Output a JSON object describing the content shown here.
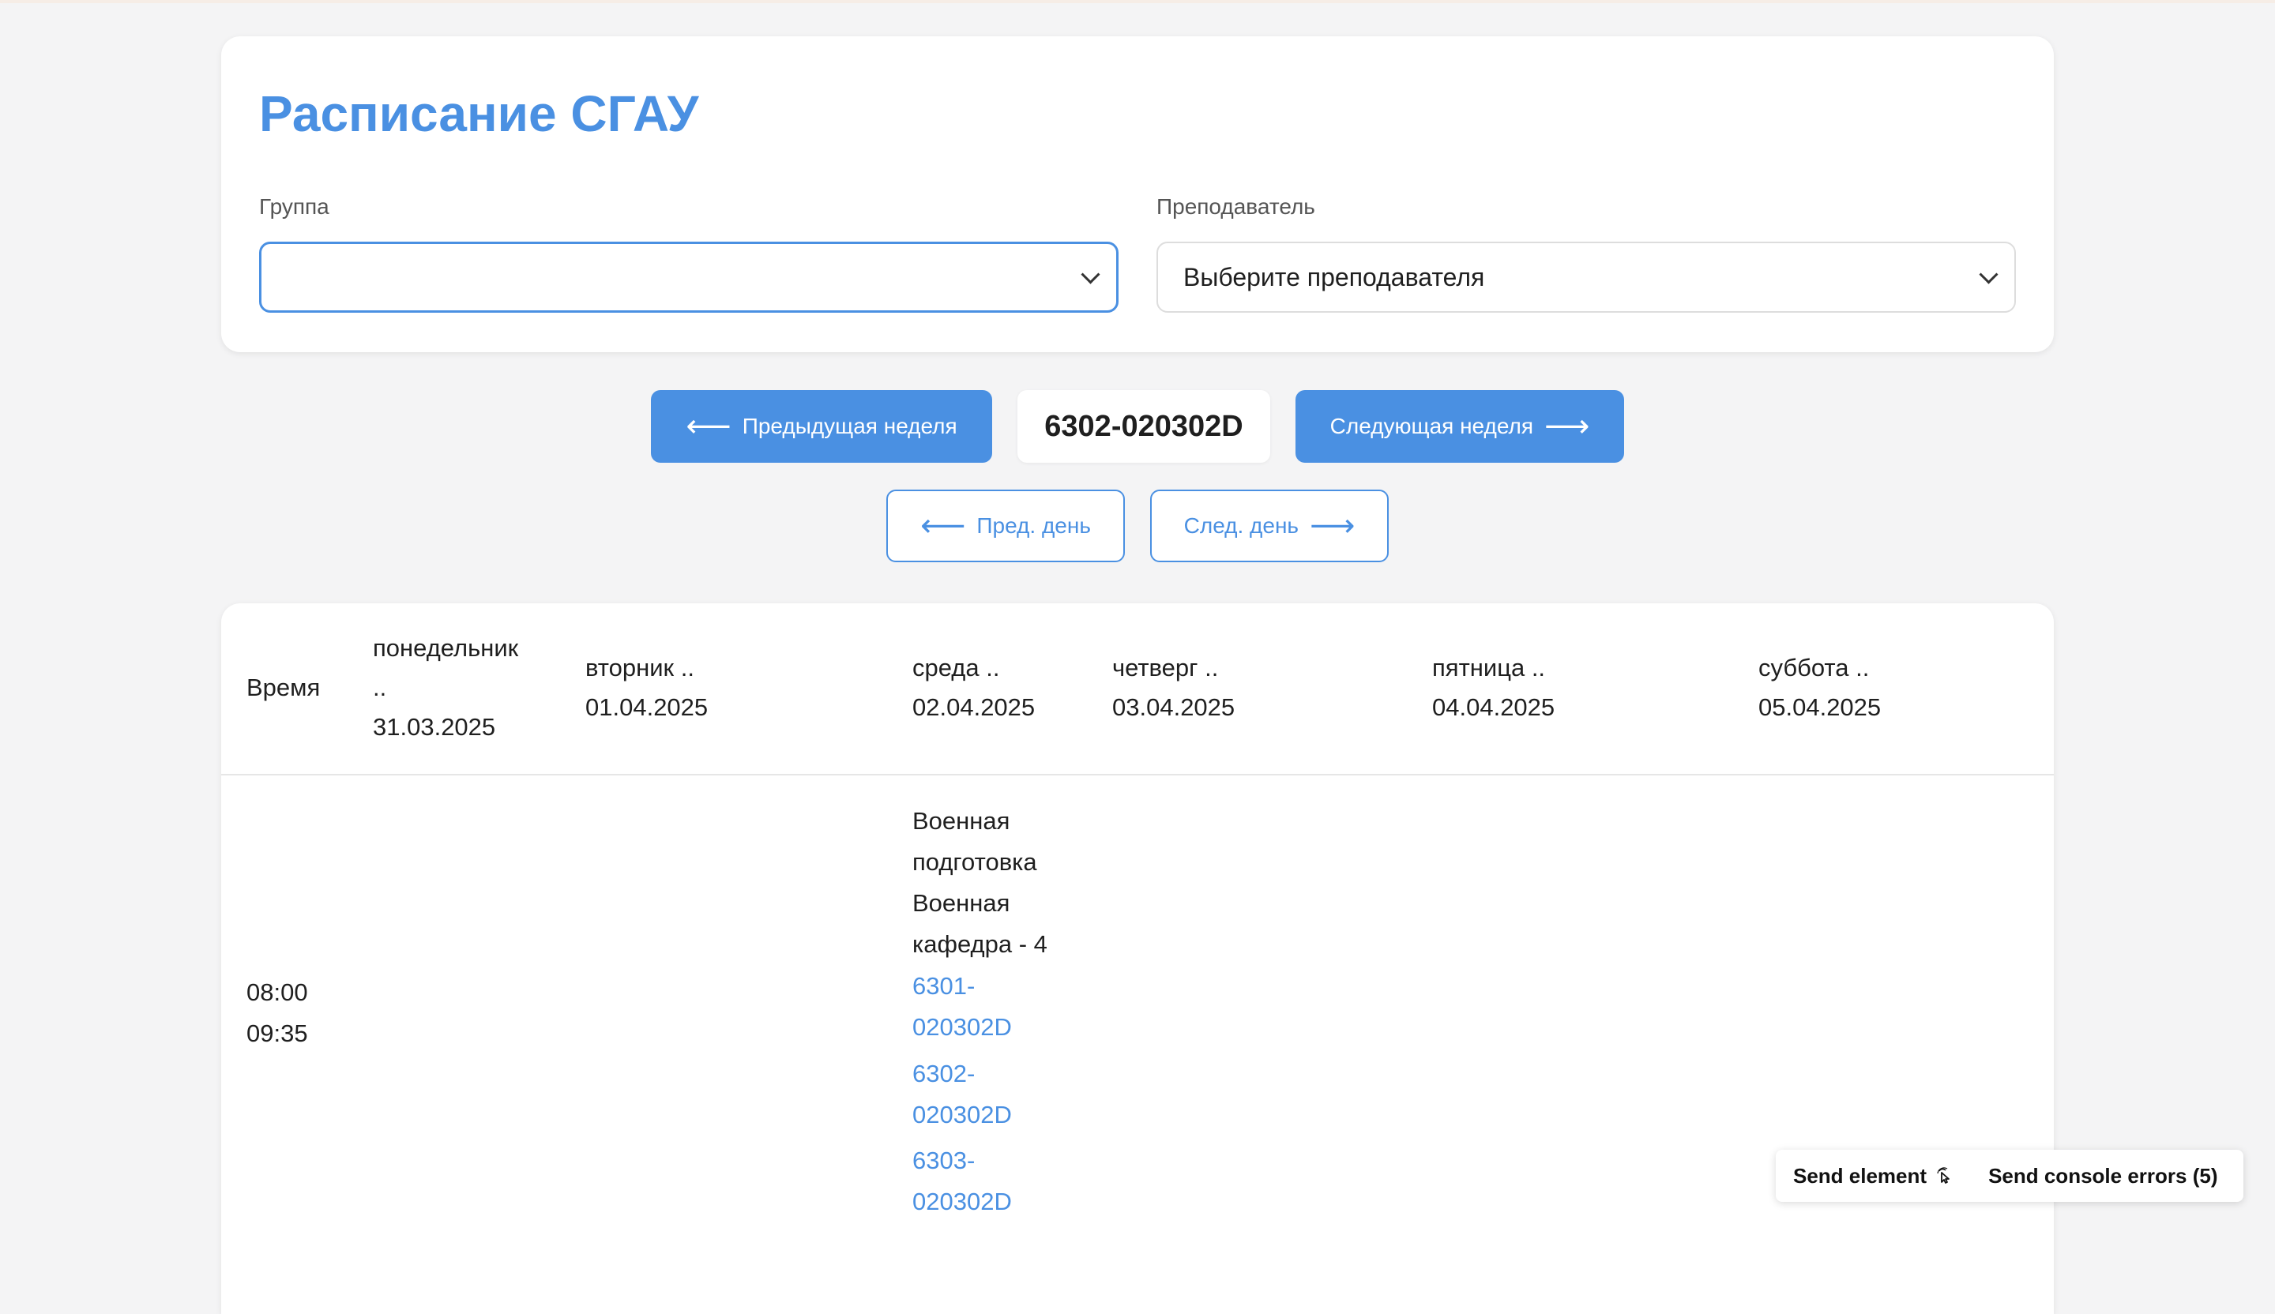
{
  "header": {
    "title": "Расписание СГАУ",
    "group_label": "Группа",
    "group_value": "",
    "teacher_label": "Преподаватель",
    "teacher_value": "Выберите преподавателя"
  },
  "navigation": {
    "prev_week": "Предыдущая неделя",
    "next_week": "Следующая неделя",
    "current_group": "6302-020302D",
    "prev_day": "Пред. день",
    "next_day": "След. день",
    "arrow_left": "⟵",
    "arrow_right": "⟶"
  },
  "table": {
    "time_header": "Время",
    "days": [
      {
        "name": "понедельник",
        "suffix": "..",
        "date": "31.03.2025"
      },
      {
        "name": "вторник ..",
        "date": "01.04.2025"
      },
      {
        "name": "среда ..",
        "date": "02.04.2025"
      },
      {
        "name": "четверг ..",
        "date": "03.04.2025"
      },
      {
        "name": "пятница ..",
        "date": "04.04.2025"
      },
      {
        "name": "суббота ..",
        "date": "05.04.2025"
      }
    ],
    "rows": [
      {
        "time_start": "08:00",
        "time_end": "09:35",
        "lesson": {
          "day": "среда",
          "subject_line1": "Военная",
          "subject_line2": "подготовка",
          "place_line1": "Военная",
          "place_line2": "кафедра - 4",
          "groups": [
            {
              "line1": "6301-",
              "line2": "020302D"
            },
            {
              "line1": "6302-",
              "line2": "020302D"
            },
            {
              "line1": "6303-",
              "line2": "020302D"
            }
          ]
        }
      }
    ]
  },
  "devtools": {
    "send_element": "Send element",
    "send_console_errors": "Send console errors (5)"
  },
  "colors": {
    "accent": "#4a90e2",
    "background": "#f4f4f5",
    "card": "#ffffff"
  }
}
